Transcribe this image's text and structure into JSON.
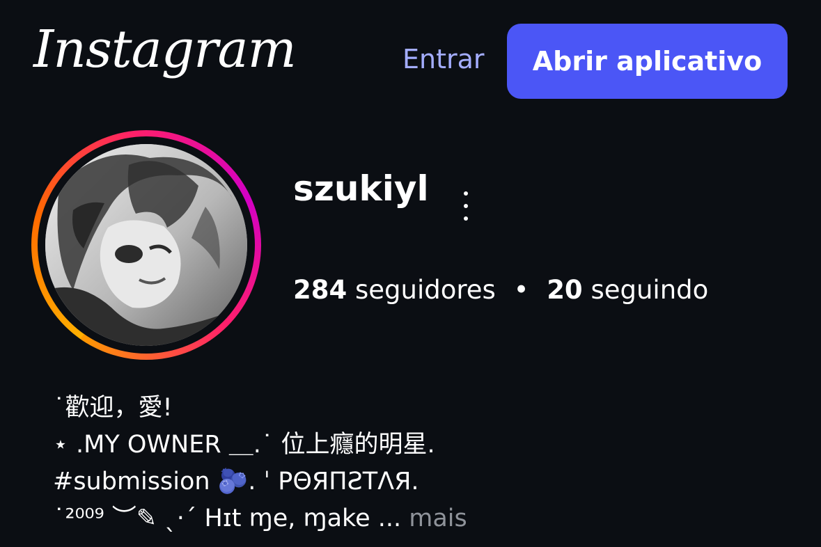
{
  "header": {
    "logo_text": "Instagram",
    "login_label": "Entrar",
    "open_app_label": "Abrir aplicativo"
  },
  "profile": {
    "username": "szukiyl",
    "more_icon": "more-vertical-icon",
    "followers_count": "284",
    "followers_label": "seguidores",
    "separator": "•",
    "following_count": "20",
    "following_label": "seguindo"
  },
  "bio": {
    "lines": [
      "˙歡迎，愛!",
      "⋆ .MY OWNER ＿.˙ 位上癮的明星.",
      "#submission 🫐. ˈ ΡΘЯΠƧΤΛЯ.",
      "˙²⁰⁰⁹ ︶✎ ˎ·ˊ Hɪt ɱe, ɱake ..."
    ],
    "more_label": "mais"
  },
  "colors": {
    "background": "#0b0e13",
    "accent_button": "#4b56f6",
    "link": "#a4adff",
    "muted": "#8f939a"
  }
}
